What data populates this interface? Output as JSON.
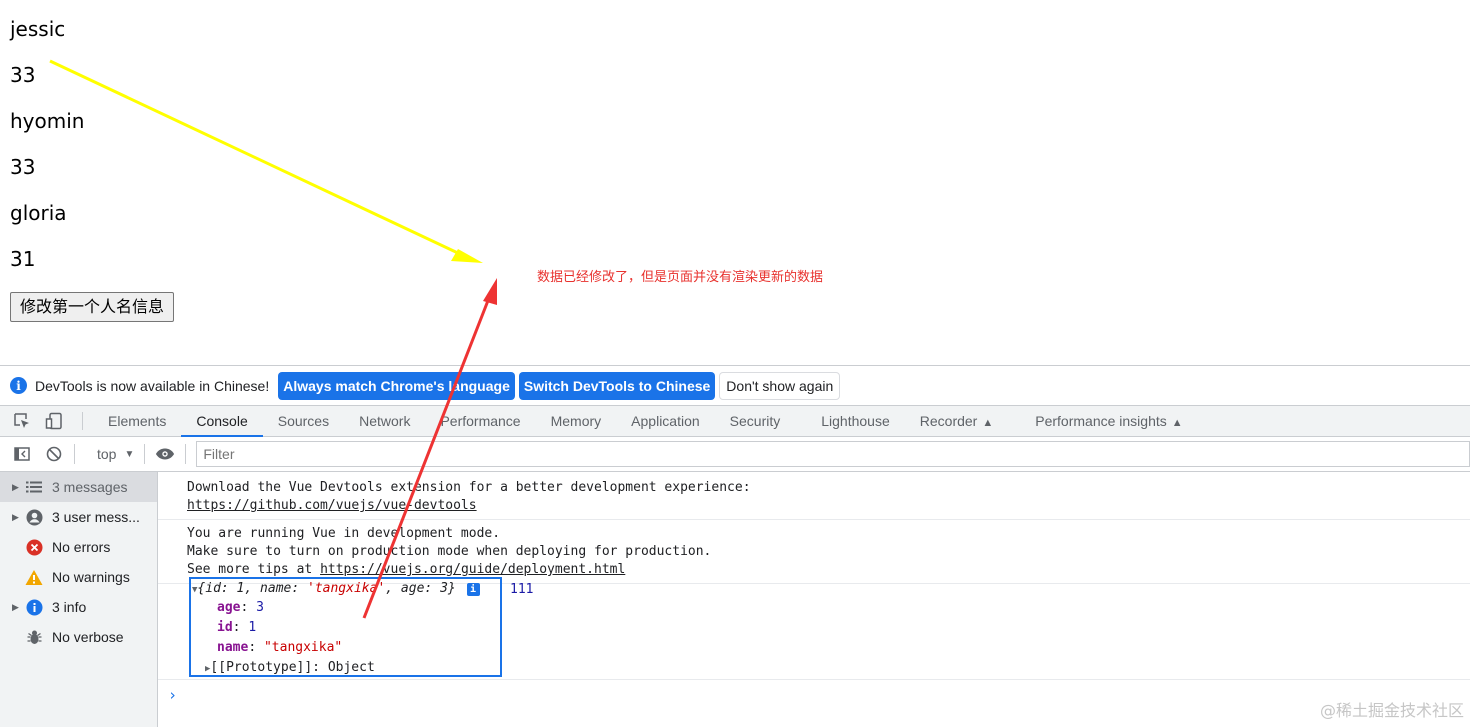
{
  "app": {
    "people": [
      {
        "name": "jessic",
        "age": "33"
      },
      {
        "name": "hyomin",
        "age": "33"
      },
      {
        "name": "gloria",
        "age": "31"
      }
    ],
    "button_label": "修改第一个人名信息",
    "annotation": "数据已经修改了，但是页面并没有渲染更新的数据"
  },
  "colors": {
    "yellow_arrow": "#ffff00",
    "red_arrow": "#ee3333",
    "accent": "#1a73e8",
    "annotation_text": "#e8322e"
  },
  "devtools": {
    "infobar": {
      "text": "DevTools is now available in Chinese!",
      "btn_match": "Always match Chrome's language",
      "btn_switch": "Switch DevTools to Chinese",
      "btn_dismiss": "Don't show again"
    },
    "tabs": [
      "Elements",
      "Console",
      "Sources",
      "Network",
      "Performance",
      "Memory",
      "Application",
      "Security",
      "Lighthouse",
      "Recorder",
      "Performance insights"
    ],
    "active_tab": "Console",
    "toolbar": {
      "context": "top",
      "filter_placeholder": "Filter"
    },
    "sidebar": [
      {
        "label": "3 messages",
        "icon": "list-icon",
        "expandable": true
      },
      {
        "label": "3 user mess...",
        "icon": "user-icon",
        "expandable": true
      },
      {
        "label": "No errors",
        "icon": "error-icon",
        "expandable": false
      },
      {
        "label": "No warnings",
        "icon": "warning-icon",
        "expandable": false
      },
      {
        "label": "3 info",
        "icon": "info-icon",
        "expandable": true
      },
      {
        "label": "No verbose",
        "icon": "bug-icon",
        "expandable": false
      }
    ],
    "console": {
      "msg1_line1": "Download the Vue Devtools extension for a better development experience:",
      "msg1_link": "https://github.com/vuejs/vue-devtools",
      "msg2_line1": "You are running Vue in development mode.",
      "msg2_line2": "Make sure to turn on production mode when deploying for production.",
      "msg2_line3_prefix": "See more tips at ",
      "msg2_link": "https://vuejs.org/guide/deployment.html",
      "object": {
        "summary_open": "{id: 1, name: ",
        "summary_name": "'tangxika'",
        "summary_mid": ", age: 3}",
        "props": [
          {
            "key": "age",
            "value": "3",
            "type": "num"
          },
          {
            "key": "id",
            "value": "1",
            "type": "num"
          },
          {
            "key": "name",
            "value": "\"tangxika\"",
            "type": "str"
          }
        ],
        "prototype": "[[Prototype]]: Object"
      },
      "log_value": "111",
      "prompt": "›"
    }
  },
  "watermark": "@稀土掘金技术社区"
}
